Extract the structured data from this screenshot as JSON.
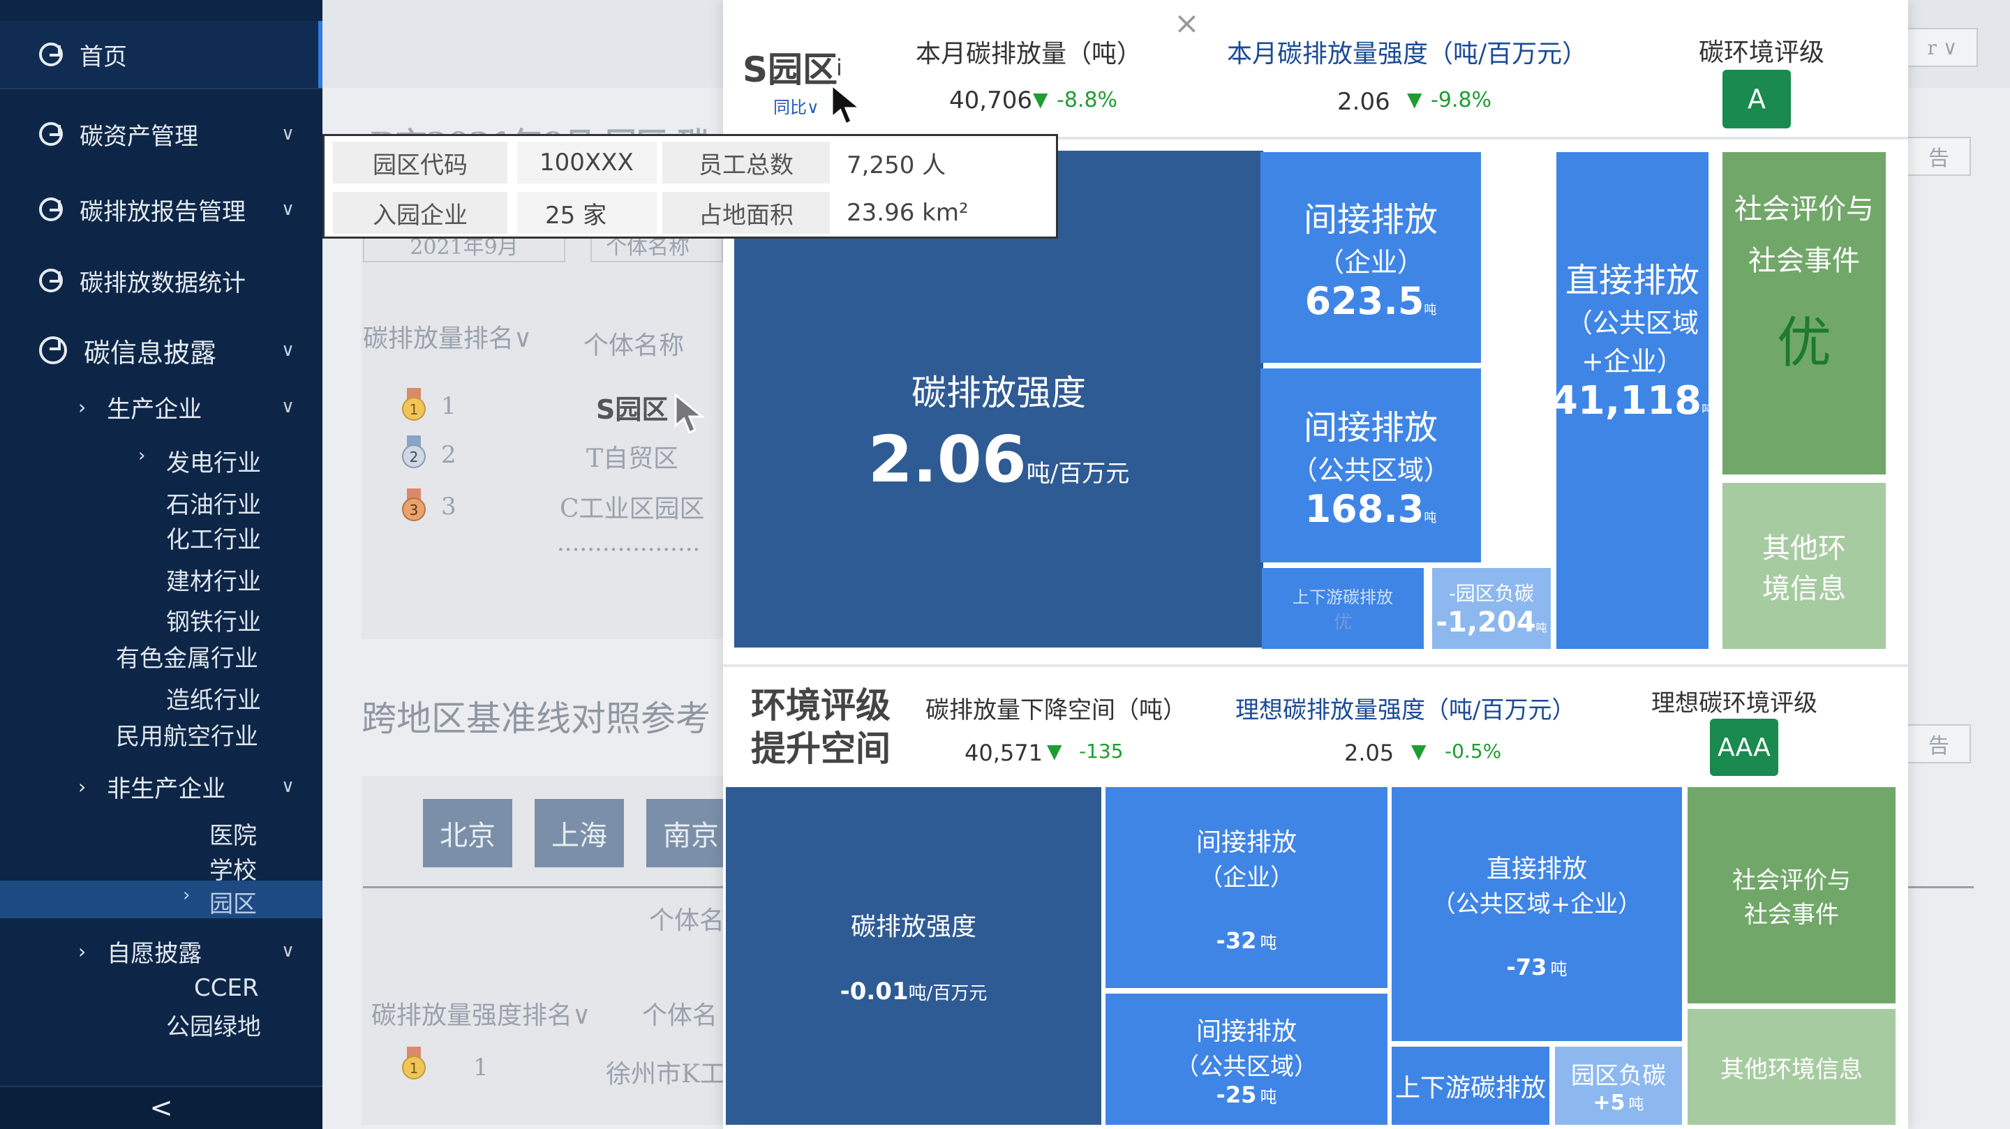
{
  "sidebar": {
    "home": "首页",
    "carbon_assets": "碳资产管理",
    "emission_reports": "碳排放报告管理",
    "emission_stats": "碳排放数据统计",
    "disclosure": "碳信息披露",
    "production": "生产企业",
    "power": "发电行业",
    "petroleum": "石油行业",
    "chemical": "化工行业",
    "building": "建材行业",
    "steel": "钢铁行业",
    "nonferrous": "有色金属行业",
    "paper": "造纸行业",
    "aviation": "民用航空行业",
    "non_production": "非生产企业",
    "hospital": "医院",
    "school": "学校",
    "park": "园区",
    "voluntary": "自愿披露",
    "ccer": "CCER",
    "green": "公园绿地",
    "collapse": "<"
  },
  "background": {
    "title_partial": "B市2021年9月 园区 碳",
    "date": "2021年9月",
    "name_field": "个体名称",
    "rank_header": "碳排放量排名∨",
    "name_header": "个体名称",
    "rank1": "1",
    "rank2": "2",
    "rank3": "3",
    "name1": "S园区",
    "name2": "T自贸区",
    "name3": "C工业区园区",
    "dots": "...................",
    "baseline_title": "跨地区基准线对照参考",
    "city1": "北京",
    "city2": "上海",
    "city3": "南京",
    "name_header2": "个体名",
    "intensity_rank_header": "碳排放量强度排名∨",
    "name_header3": "个体名",
    "rank1b": "1",
    "name1b": "徐州市K工",
    "right_btn1": "告",
    "right_btn2": "告",
    "right_select": "r ∨"
  },
  "popup": {
    "close": "×",
    "title": "S园区",
    "info_mark": "i",
    "yoy": "同比∨",
    "month_emission_label": "本月碳排放量（吨）",
    "month_emission_value": "40,706",
    "month_emission_change": "-8.8%",
    "month_intensity_label": "本月碳排放量强度（吨/百万元）",
    "month_intensity_value": "2.06",
    "month_intensity_change": "-9.8%",
    "rating_label": "碳环境评级",
    "rating_value": "A",
    "tiles": {
      "intensity_title": "碳排放强度",
      "intensity_value": "2.06",
      "intensity_unit": "吨/百万元",
      "indirect_ent_title": "间接排放",
      "indirect_ent_sub": "（企业）",
      "indirect_ent_value": "623.5",
      "indirect_pub_title": "间接排放",
      "indirect_pub_sub": "（公共区域）",
      "indirect_pub_value": "168.3",
      "ton": "吨",
      "direct_title": "直接排放",
      "direct_sub1": "（公共区域",
      "direct_sub2": "+企业）",
      "direct_value": "41,118",
      "social_title1": "社会评价与",
      "social_title2": "社会事件",
      "social_value": "优",
      "other_env1": "其他环",
      "other_env2": "境信息",
      "updown_title": "上下游碳排放",
      "updown_value": "优",
      "neg_title": "-园区负碳",
      "neg_value": "-1,204"
    },
    "improve_title1": "环境评级",
    "improve_title2": "提升空间",
    "reduce_label": "碳排放量下降空间（吨）",
    "reduce_value": "40,571",
    "reduce_change": "-135",
    "ideal_intensity_label": "理想碳排放量强度（吨/百万元）",
    "ideal_intensity_value": "2.05",
    "ideal_intensity_change": "-0.5%",
    "ideal_rating_label": "理想碳环境评级",
    "ideal_rating_value": "AAA",
    "tiles2": {
      "intensity_title": "碳排放强度",
      "intensity_value": "-0.01",
      "intensity_unit": "吨/百万元",
      "indirect_ent_title": "间接排放",
      "indirect_ent_sub": "（企业）",
      "indirect_ent_value": "-32",
      "indirect_pub_title": "间接排放",
      "indirect_pub_sub": "（公共区域）",
      "indirect_pub_value": "-25",
      "direct_title": "直接排放",
      "direct_sub": "（公共区域+企业）",
      "direct_value": "-73",
      "social_title1": "社会评价与",
      "social_title2": "社会事件",
      "other_env": "其他环境信息",
      "updown_title": "上下游碳排放",
      "neg_title": "园区负碳",
      "neg_value": "+5",
      "ton": "吨"
    }
  },
  "info_table": {
    "code_label": "园区代码",
    "code_value": "100XXX",
    "staff_label": "员工总数",
    "staff_value": "7,250 人",
    "ent_label": "入园企业",
    "ent_value": "25 家",
    "area_label": "占地面积",
    "area_value": "23.96 km²"
  },
  "colors": {
    "sidebar": "#0d2647",
    "tile_dark": "#2f5b94",
    "tile_blue": "#3f85e6",
    "tile_light": "#8db8ef",
    "tile_green": "#71a869",
    "tile_light_green": "#a7cba1",
    "rating_badge": "#1a8a4f",
    "down_arrow": "#1f9d33"
  },
  "icons": {
    "nav": "pie-chart-icon",
    "medal": "medal-icon",
    "cursor": "cursor-arrow-icon",
    "close": "close-icon"
  }
}
